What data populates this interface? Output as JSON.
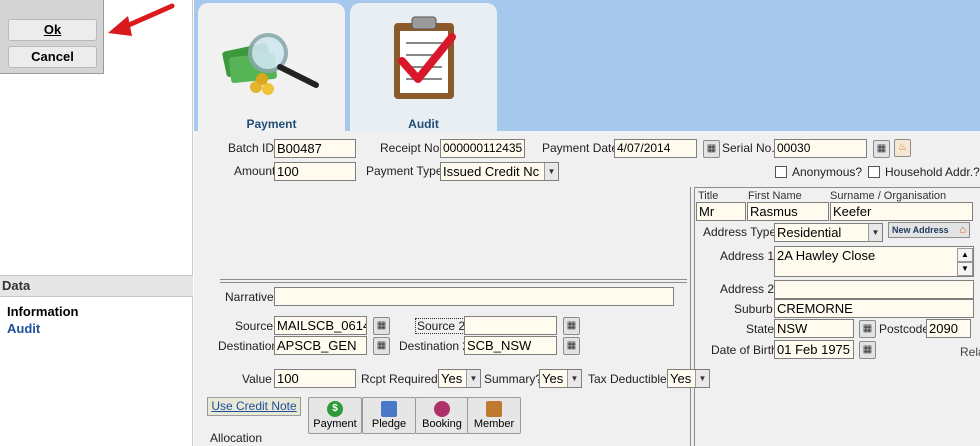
{
  "dialog": {
    "ok_label": "Ok",
    "cancel_label": "Cancel"
  },
  "sidebar": {
    "header": "Data",
    "items": [
      {
        "label": "Information"
      },
      {
        "label": "Audit"
      }
    ]
  },
  "tabs": [
    {
      "label": "Payment"
    },
    {
      "label": "Audit"
    }
  ],
  "form": {
    "batch_id": {
      "label": "Batch ID",
      "value": "B00487"
    },
    "receipt_no": {
      "label": "Receipt No.",
      "value": "000000112435"
    },
    "payment_date": {
      "label": "Payment Date",
      "value": "4/07/2014"
    },
    "serial_no": {
      "label": "Serial No.",
      "value": "00030"
    },
    "amount": {
      "label": "Amount",
      "value": "100"
    },
    "payment_type": {
      "label": "Payment Type",
      "value": "Issued Credit Nc"
    },
    "anonymous": {
      "label": "Anonymous?"
    },
    "household": {
      "label": "Household Addr.?"
    },
    "narrative": {
      "label": "Narrative",
      "value": ""
    },
    "source": {
      "label": "Source",
      "value": "MAILSCB_0614"
    },
    "source2": {
      "label": "Source 2",
      "value": ""
    },
    "destination": {
      "label": "Destination",
      "value": "APSCB_GEN"
    },
    "destination2": {
      "label": "Destination 2",
      "value": "SCB_NSW"
    },
    "value": {
      "label": "Value",
      "value": "100"
    },
    "rcpt_required": {
      "label": "Rcpt Required?",
      "value": "Yes"
    },
    "summary": {
      "label": "Summary?",
      "value": "Yes"
    },
    "tax_deductible": {
      "label": "Tax Deductible?",
      "value": "Yes"
    },
    "allocation_label": "Allocation",
    "use_credit_note": "Use Credit Note"
  },
  "contact": {
    "title_hdr": "Title",
    "firstname_hdr": "First Name",
    "surname_hdr": "Surname / Organisation",
    "title": "Mr",
    "first_name": "Rasmus",
    "surname": "Keefer",
    "address_type": {
      "label": "Address Type",
      "value": "Residential"
    },
    "new_address": "New Address",
    "address1": {
      "label": "Address 1",
      "value": "2A Hawley Close"
    },
    "address2": {
      "label": "Address 2",
      "value": ""
    },
    "suburb": {
      "label": "Suburb",
      "value": "CREMORNE"
    },
    "state": {
      "label": "State",
      "value": "NSW"
    },
    "postcode": {
      "label": "Postcode",
      "value": "2090"
    },
    "dob": {
      "label": "Date of Birth",
      "value": "01 Feb 1975"
    },
    "rel_partial": "Rela"
  },
  "alloc_buttons": [
    {
      "label": "Payment",
      "color": "#2e9a3a"
    },
    {
      "label": "Pledge",
      "color": "#4a78c8"
    },
    {
      "label": "Booking",
      "color": "#b0306a"
    },
    {
      "label": "Member",
      "color": "#c07a30"
    }
  ],
  "colors": {
    "accent": "#a6c8ec",
    "arrow": "#d9191c",
    "link": "#1f4e9a"
  }
}
